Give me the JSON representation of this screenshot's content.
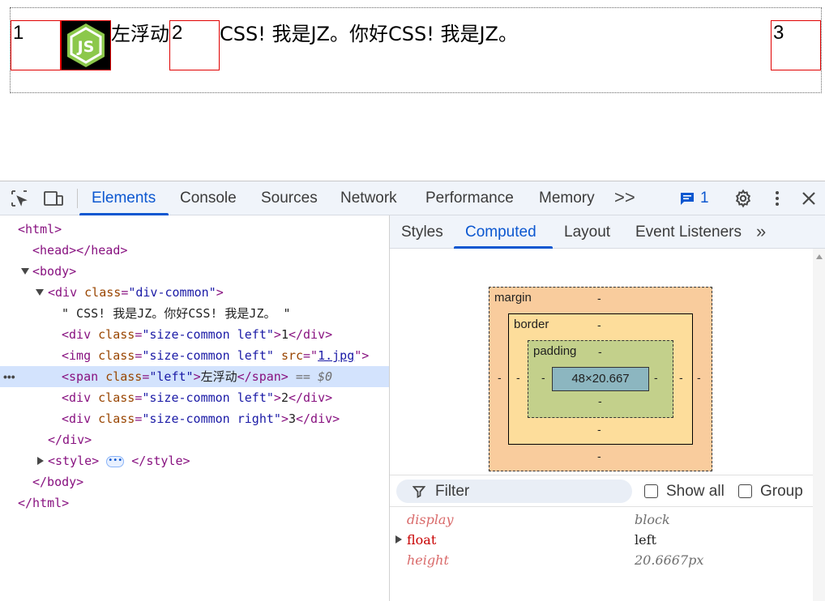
{
  "page": {
    "box1": "1",
    "box2": "2",
    "box3": "3",
    "float_text": "左浮动",
    "flow_text": "CSS! 我是JZ。你好CSS! 我是JZ。",
    "image_icon": "nodejs-logo-icon"
  },
  "devtools": {
    "tabs": [
      "Elements",
      "Console",
      "Sources",
      "Network",
      "Performance",
      "Memory"
    ],
    "active_tab": "Elements",
    "more": ">>",
    "issues_count": "1",
    "toolbar_icons": [
      "inspect-element-icon",
      "device-toolbar-icon",
      "issues-icon",
      "settings-icon",
      "more-vert-icon",
      "close-icon"
    ],
    "dom": {
      "html_open": "<html>",
      "head": "<head></head>",
      "body_open": "<body>",
      "div_open_tag": "<div ",
      "div_attr": "class",
      "div_val": "\"div-common\"",
      "text_node": "\" CSS! 我是JZ。你好CSS! 我是JZ。 \"",
      "div1_val": "\"size-common left\"",
      "div1_text": "1",
      "img_val": "\"size-common left\"",
      "img_src_attr": "src",
      "img_src": "1.jpg",
      "span_val": "\"left\"",
      "span_text": "左浮动",
      "span_eq": "== $0",
      "div2_val": "\"size-common left\"",
      "div2_text": "2",
      "div3_val": "\"size-common right\"",
      "div3_text": "3",
      "div_close": "</div>",
      "style_open": "<style>",
      "style_close": "</style>",
      "body_close": "</body>",
      "html_close": "</html>",
      "row_dots": "•••"
    },
    "right_tabs": [
      "Styles",
      "Computed",
      "Layout",
      "Event Listeners"
    ],
    "active_right_tab": "Computed",
    "box_model": {
      "margin_label": "margin",
      "border_label": "border",
      "padding_label": "padding",
      "content": "48×20.667",
      "dash": "-"
    },
    "filter": {
      "label": "Filter",
      "show_all": "Show all",
      "group": "Group"
    },
    "properties": [
      {
        "name": "display",
        "value": "block",
        "inherited": true
      },
      {
        "name": "float",
        "value": "left",
        "inherited": false
      },
      {
        "name": "height",
        "value": "20.6667px",
        "inherited": true
      }
    ]
  }
}
